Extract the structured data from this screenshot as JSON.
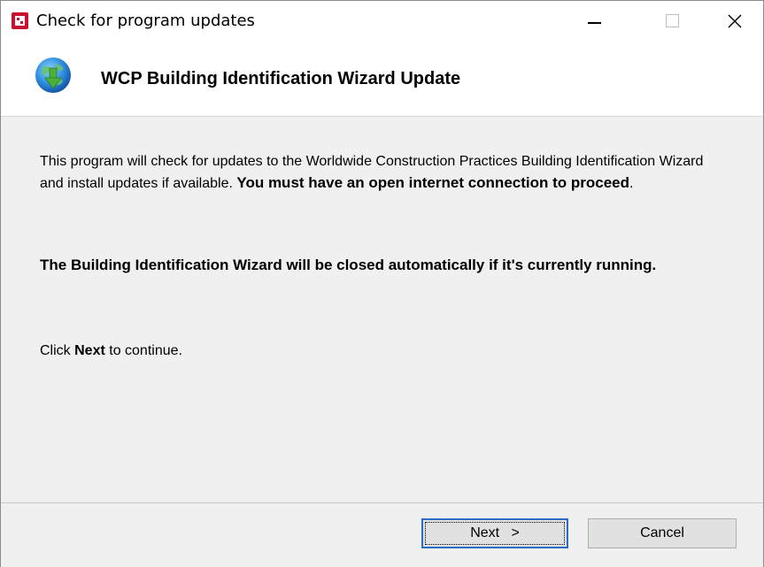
{
  "window": {
    "title": "Check for program updates"
  },
  "header": {
    "title": "WCP Building Identification Wizard Update",
    "icon": "globe-download-icon"
  },
  "content": {
    "p1_start": "This program will check for updates to the Worldwide Construction Practices Building Identification Wizard and install updates if available. ",
    "p1_bold": "You must have an open internet connection to proceed",
    "p1_end": ".",
    "p2": "The Building Identification Wizard will be closed automatically if it's currently running.",
    "p3_start": "Click ",
    "p3_bold": "Next",
    "p3_end": " to continue."
  },
  "footer": {
    "next_label": "Next   >",
    "cancel_label": "Cancel"
  },
  "colors": {
    "app_icon": "#c8102e",
    "focus_border": "#2b6cc7",
    "dialog_bg": "#f0f0f0"
  }
}
